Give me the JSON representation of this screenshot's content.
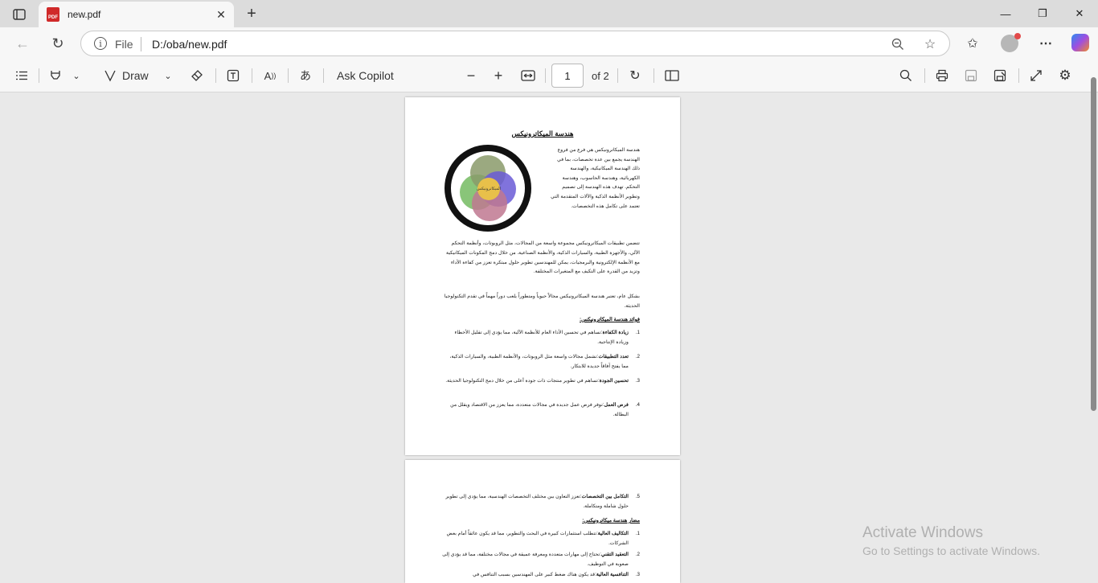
{
  "tab": {
    "title": "new.pdf",
    "icon": "pdf-file-icon"
  },
  "address": {
    "scheme": "File",
    "url": "D:/oba/new.pdf"
  },
  "pdf_toolbar": {
    "draw_label": "Draw",
    "ask_copilot_label": "Ask Copilot",
    "page_current": "1",
    "page_total": "of 2"
  },
  "page1": {
    "title": "هندسة الميكاترونيكس",
    "intro": "هندسة الميكاترونيكس هي فرع من فروع الهندسة يجمع بين عدة تخصصات، بما في ذلك الهندسة الميكانيكية، والهندسة الكهربائية، وهندسة الحاسوب، وهندسة التحكم. تهدف هذه الهندسة إلى تصميم وتطوير الأنظمة الذكية والآلات المتقدمة التي تعتمد على تكامل هذه التخصصات.",
    "para1": "تتضمن تطبيقات الميكاترونيكس مجموعة واسعة من المجالات، مثل الروبوتات، وأنظمة التحكم الآلي، والأجهزة الطبية، والسيارات الذكية، والأنظمة الصناعية. من خلال دمج المكونات الميكانيكية مع الأنظمة الإلكترونية والبرمجيات، يمكن للمهندسين تطوير حلول مبتكرة تعزز من كفاءة الأداء وتزيد من القدرة على التكيف مع المتغيرات المختلفة.",
    "para2": "بشكل عام، تعتبر هندسة الميكاترونيكس مجالاً حيوياً ومتطوراً يلعب دوراً مهماً في تقدم التكنولوجيا الحديثة.",
    "benefits_heading": "فوائد هندسة الميكاترونيكس:",
    "benefits": [
      {
        "num": "1.",
        "term": "زيادة الكفاءة",
        "text": ":تساهم في تحسين الأداء العام للأنظمة الآلية، مما يؤدي إلى تقليل الأخطاء وزيادة الإنتاجية."
      },
      {
        "num": "2.",
        "term": "تعدد التطبيقات",
        "text": ":تشمل مجالات واسعة مثل الروبوتات، والأنظمة الطبية، والسيارات الذكية، مما يفتح آفاقاً جديدة للابتكار."
      },
      {
        "num": "3.",
        "term": "تحسين الجودة",
        "text": ":تساهم في تطوير منتجات ذات جودة أعلى من خلال دمج التكنولوجيا الحديثة."
      },
      {
        "num": "4.",
        "term": "فرص العمل",
        "text": ":توفر فرص عمل جديدة في مجالات متعددة، مما يعزز من الاقتصاد ويقلل من البطالة."
      }
    ],
    "wheel_center": "الميكاترونيكس"
  },
  "page2": {
    "item5": {
      "num": "5.",
      "term": "التكامل بين التخصصات",
      "text": ":تعزز التعاون بين مختلف التخصصات الهندسية، مما يؤدي إلى تطوير حلول شاملة ومتكاملة."
    },
    "risks_heading": "مضار هندسة ميكاترونيكس:",
    "risks": [
      {
        "num": "1.",
        "term": "التكاليف العالية",
        "text": ":تتطلب استثمارات كبيرة في البحث والتطوير، مما قد يكون عائقاً أمام بعض الشركات."
      },
      {
        "num": "2.",
        "term": "التعقيد التقني",
        "text": ":تحتاج إلى مهارات متعددة ومعرفة عميقة في مجالات مختلفة، مما قد يؤدي إلى صعوبة في التوظيف."
      },
      {
        "num": "3.",
        "term": "التنافسية العالية",
        "text": ":قد يكون هناك ضغط كبير على المهندسين بسبب التنافس في"
      }
    ]
  },
  "watermark": {
    "line1": "Activate Windows",
    "line2": "Go to Settings to activate Windows."
  }
}
